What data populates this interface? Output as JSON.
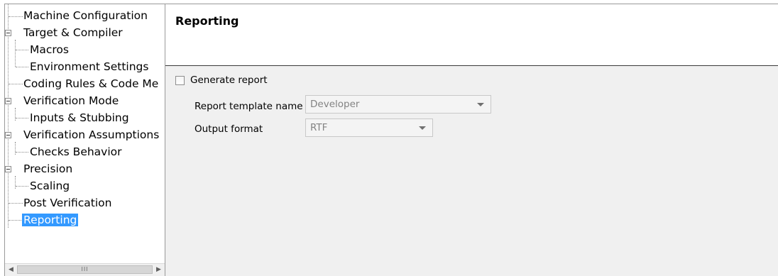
{
  "tree": {
    "items": [
      {
        "label": "Machine Configuration"
      },
      {
        "label": "Target & Compiler"
      },
      {
        "label": "Macros"
      },
      {
        "label": "Environment Settings"
      },
      {
        "label": "Coding Rules & Code Me"
      },
      {
        "label": "Verification Mode"
      },
      {
        "label": "Inputs & Stubbing"
      },
      {
        "label": "Verification Assumptions"
      },
      {
        "label": "Checks Behavior"
      },
      {
        "label": "Precision"
      },
      {
        "label": "Scaling"
      },
      {
        "label": "Post Verification"
      },
      {
        "label": "Reporting",
        "selected": true
      }
    ],
    "scrollbar_thumb_grip": "III"
  },
  "content": {
    "title": "Reporting",
    "generate_report": {
      "label": "Generate report",
      "checked": false
    },
    "report_template": {
      "label": "Report template name",
      "value": "Developer",
      "enabled": false
    },
    "output_format": {
      "label": "Output format",
      "value": "RTF",
      "enabled": false
    }
  },
  "colors": {
    "selection": "#3399ff",
    "panel_bg": "#f0f0f0",
    "disabled_text": "#838383"
  }
}
